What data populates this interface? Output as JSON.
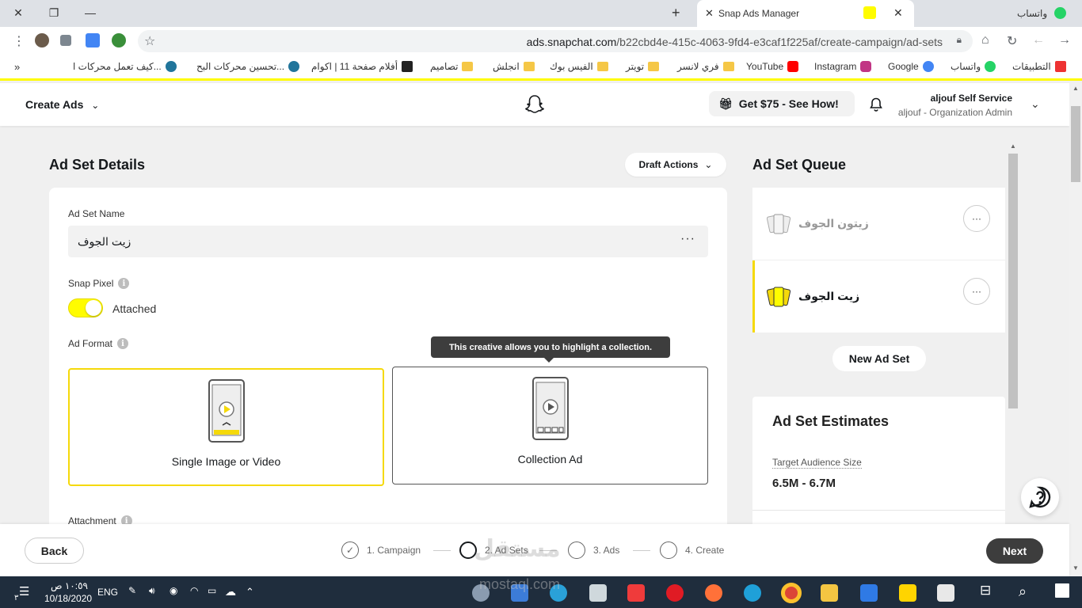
{
  "browser": {
    "active_tab_title": "Snap Ads Manager",
    "other_tab_title": "واتساب",
    "url_host": "ads.snapchat.com",
    "url_path": "/b22cbd4e-415c-4063-9fd4-e3caf1f225af/create-campaign/ad-sets",
    "bookmarks": [
      {
        "label": "التطبيقات",
        "icon": "apps-grid-icon"
      },
      {
        "label": "واتساب",
        "icon": "whatsapp-icon"
      },
      {
        "label": "Google",
        "icon": "google-icon"
      },
      {
        "label": "Instagram",
        "icon": "instagram-icon"
      },
      {
        "label": "YouTube",
        "icon": "youtube-icon"
      },
      {
        "label": "فري لانسر",
        "icon": "folder-icon"
      },
      {
        "label": "تويتر",
        "icon": "folder-icon"
      },
      {
        "label": "الفيس بوك",
        "icon": "folder-icon"
      },
      {
        "label": "انجلش",
        "icon": "folder-icon"
      },
      {
        "label": "تصاميم",
        "icon": "folder-icon"
      },
      {
        "label": "أفلام صفحة 11 | اكوام",
        "icon": "akwam-icon"
      },
      {
        "label": "تحسين محركات البح...",
        "icon": "wordpress-icon"
      },
      {
        "label": "كيف تعمل محركات ا...",
        "icon": "wordpress-icon"
      }
    ],
    "bookmarks_overflow": "»"
  },
  "header": {
    "create_ads": "Create Ads",
    "promo": "Get $75 - See How!",
    "account_name": "aljouf Self Service",
    "account_role": "aljouf - Organization Admin"
  },
  "details": {
    "title": "Ad Set Details",
    "draft_actions": "Draft Actions",
    "name_label": "Ad Set Name",
    "name_value": "زيت الجوف",
    "name_more": "···",
    "pixel_label": "Snap Pixel",
    "pixel_state": "Attached",
    "format_label": "Ad Format",
    "format_single": "Single Image or Video",
    "format_collection": "Collection Ad",
    "tooltip": "This creative allows you to highlight a collection.",
    "attachment_label": "Attachment"
  },
  "queue": {
    "title": "Ad Set Queue",
    "items": [
      {
        "name": "زيتون الجوف",
        "more": "···"
      },
      {
        "name": "زيت الجوف",
        "more": "···"
      }
    ],
    "new_button": "New Ad Set"
  },
  "estimates": {
    "title": "Ad Set Estimates",
    "audience_label": "Target Audience Size",
    "audience_value": "6.5M - 6.7M"
  },
  "footer": {
    "back": "Back",
    "next": "Next",
    "steps": [
      "1. Campaign",
      "2. Ad Sets",
      "3. Ads",
      "4. Create"
    ]
  },
  "watermark": {
    "arabic": "مستقل",
    "latin": "mostaql.com"
  },
  "taskbar": {
    "time": "١٠:٥٩ ص",
    "date": "10/18/2020",
    "lang": "ENG",
    "notif_count": "٣"
  },
  "colors": {
    "snap_yellow": "#fffc00",
    "taskbar": "#1f2d3d",
    "next_button": "#3d3d3d"
  }
}
